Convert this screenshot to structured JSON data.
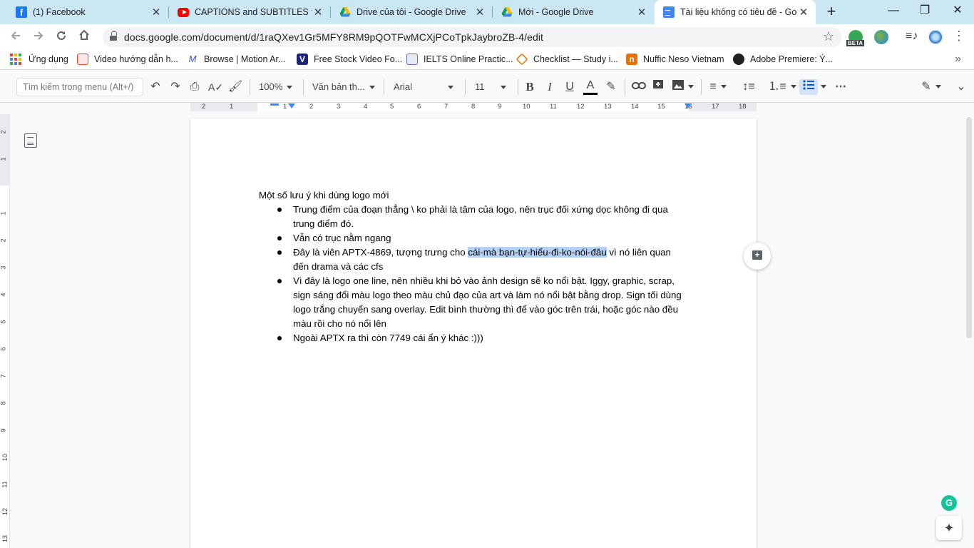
{
  "browser": {
    "tabs": [
      {
        "title": "(1) Facebook",
        "icon": "facebook-icon"
      },
      {
        "title": "CAPTIONS and SUBTITLES tuto",
        "icon": "youtube-icon"
      },
      {
        "title": "Drive của tôi - Google Drive",
        "icon": "google-drive-icon"
      },
      {
        "title": "Mới - Google Drive",
        "icon": "google-drive-icon"
      },
      {
        "title": "Tài liệu không có tiêu đề - Goo",
        "icon": "google-docs-icon"
      }
    ],
    "url": "docs.google.com/document/d/1raQXev1Gr5MFY8RM9pQOTFwMCXjPCoTpkJaybroZB-4/edit",
    "extension_beta_label": "BETA"
  },
  "bookmarks": [
    {
      "label": "Ứng dụng",
      "icon": "apps-grid-icon"
    },
    {
      "label": "Video hướng dẫn h...",
      "icon": "video-icon"
    },
    {
      "label": "Browse | Motion Ar...",
      "icon": "motion-array-icon"
    },
    {
      "label": "Free Stock Video Fo...",
      "icon": "videvo-icon"
    },
    {
      "label": "IELTS Online Practic...",
      "icon": "ielts-icon"
    },
    {
      "label": "Checklist — Study i...",
      "icon": "checklist-icon"
    },
    {
      "label": "Nuffic Neso Vietnam",
      "icon": "nuffic-icon"
    },
    {
      "label": "Adobe Premiere: Ý...",
      "icon": "adobe-icon"
    }
  ],
  "toolbar": {
    "menu_search_placeholder": "Tìm kiếm trong menu (Alt+/)",
    "zoom": "100%",
    "style": "Văn bản th...",
    "font": "Arial",
    "font_size": "11"
  },
  "ruler": {
    "numbers": [
      "2",
      "1",
      "1",
      "2",
      "3",
      "4",
      "5",
      "6",
      "7",
      "8",
      "9",
      "10",
      "11",
      "12",
      "13",
      "14",
      "15",
      "16",
      "17",
      "18"
    ],
    "vertical_numbers": [
      "2",
      "1",
      "1",
      "2",
      "3",
      "4",
      "5",
      "6",
      "7",
      "8",
      "9",
      "10",
      "11",
      "12",
      "13"
    ]
  },
  "document": {
    "title_line": "Một số lưu ý khi dùng logo mới",
    "bullets": [
      {
        "text": "Trung điểm của đoạn thẳng \\ ko phải là tâm của logo, nên trục đối xứng dọc không đi qua trung điểm đó."
      },
      {
        "text": "Vẫn có trục nằm ngang"
      },
      {
        "before": "Đây là viên APTX-4869, tượng trưng cho ",
        "highlight": "cái-mà bạn-tự-hiểu-đi-ko-nói-đâu",
        "after": " vì nó liên quan đến drama và các cfs"
      },
      {
        "text": "Vì đây là logo one line, nên nhiều khi bỏ vào ảnh design sẽ ko nổi bật. Iggy, graphic, scrap, sign sáng đổi màu logo theo màu chủ đạo của art và làm nó nổi bật bằng drop. Sign tối dùng logo trắng chuyển sang overlay. Edit bình thường thì để vào góc trên trái, hoặc góc nào đều màu rồi cho nó nổi lên"
      },
      {
        "text": "Ngoài APTX ra thì còn 7749 cái ẩn ý khác :)))"
      }
    ]
  },
  "colors": {
    "tab_strip": "#cce7f4",
    "selection_highlight": "#b4d2f5",
    "accent": "#4285f4"
  }
}
